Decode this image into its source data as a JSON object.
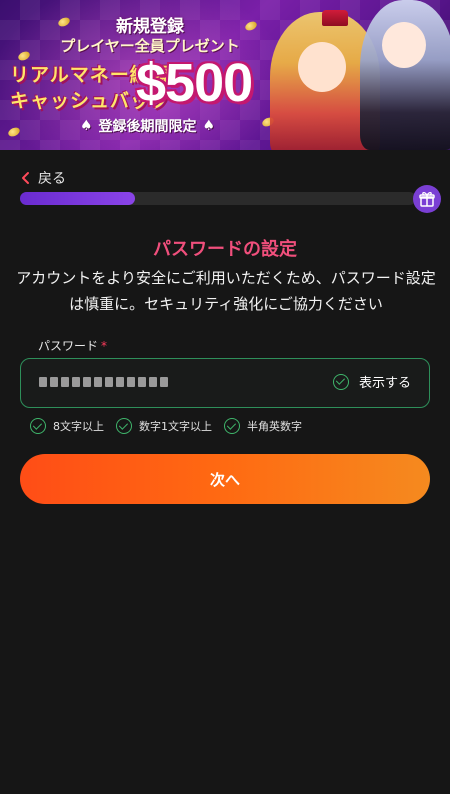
{
  "banner": {
    "title_line1": "新規登録",
    "title_line2": "プレイヤー全員プレゼント",
    "promo_line1": "リアルマネー総額",
    "promo_line2": "キャッシュバック",
    "amount": "$500",
    "period": "登録後期間限定"
  },
  "nav": {
    "back_label": "戻る"
  },
  "progress": {
    "fraction": 0.29
  },
  "page": {
    "title": "パスワードの設定",
    "description": "アカウントをより安全にご利用いただくため、パスワード設定は慎重に。セキュリティ強化にご協力ください"
  },
  "password_field": {
    "label": "パスワード",
    "required_mark": "*",
    "masked_value": "●●●●●●●●●●●●",
    "toggle_label": "表示する"
  },
  "rules": [
    {
      "label": "8文字以上"
    },
    {
      "label": "数字1文字以上"
    },
    {
      "label": "半角英数字"
    }
  ],
  "next_button": {
    "label": "次へ"
  },
  "colors": {
    "accent_pink": "#f04f7c",
    "success_green": "#3fb56b",
    "progress_purple": "#7a3fd4",
    "button_orange": "#ff5a14",
    "background": "#161616"
  }
}
